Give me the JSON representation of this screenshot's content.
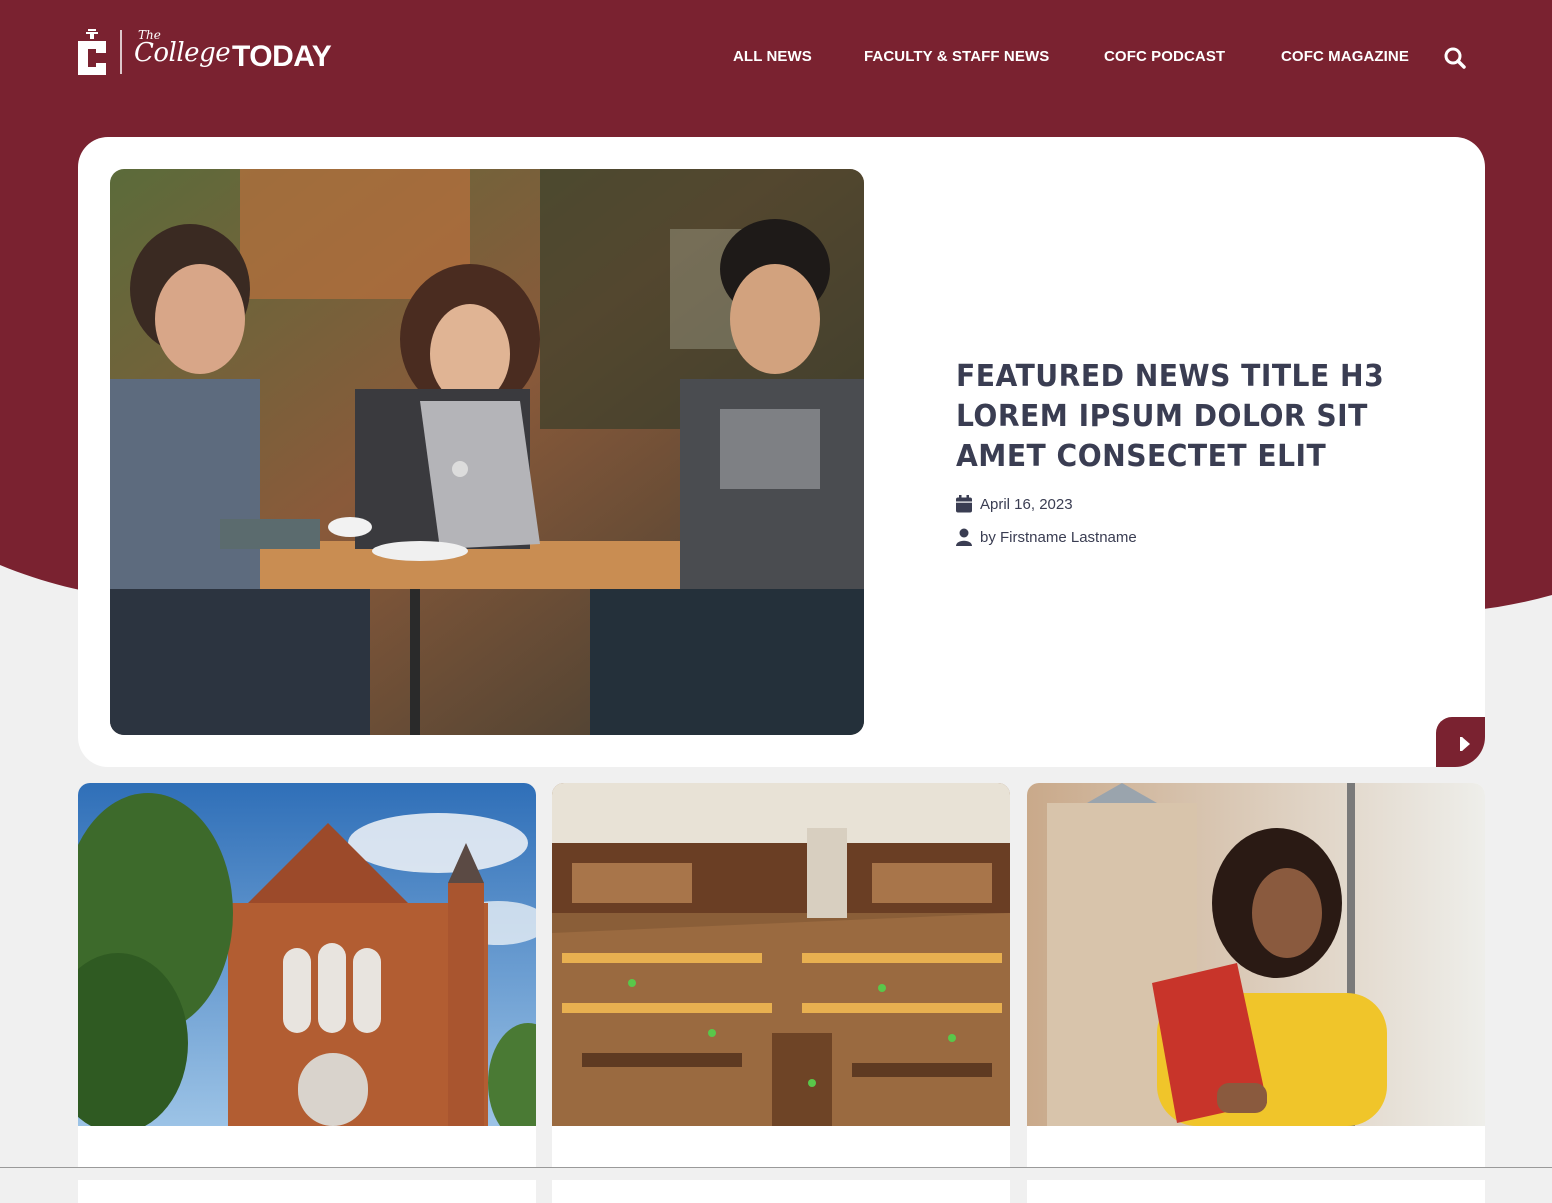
{
  "brand": {
    "logo_the": "The",
    "logo_college": "College",
    "logo_today": "TODAY",
    "primary_color": "#7a2230",
    "heading_color": "#3a3d52"
  },
  "nav": {
    "items": [
      {
        "label": "ALL NEWS"
      },
      {
        "label": "FACULTY & STAFF NEWS"
      },
      {
        "label": "COFC PODCAST"
      },
      {
        "label": "COFC MAGAZINE"
      }
    ],
    "search_icon": "search-icon"
  },
  "featured": {
    "title": "Featured News Title H3 Lorem ipsum dolor sit amet consectet elit",
    "date": "April 16, 2023",
    "author": "by Firstname Lastname",
    "date_icon": "calendar-icon",
    "author_icon": "user-icon",
    "next_icon": "play-icon"
  },
  "cards": [
    {
      "image": "brick-building-photo"
    },
    {
      "image": "library-reading-room-photo"
    },
    {
      "image": "student-with-books-photo"
    }
  ]
}
